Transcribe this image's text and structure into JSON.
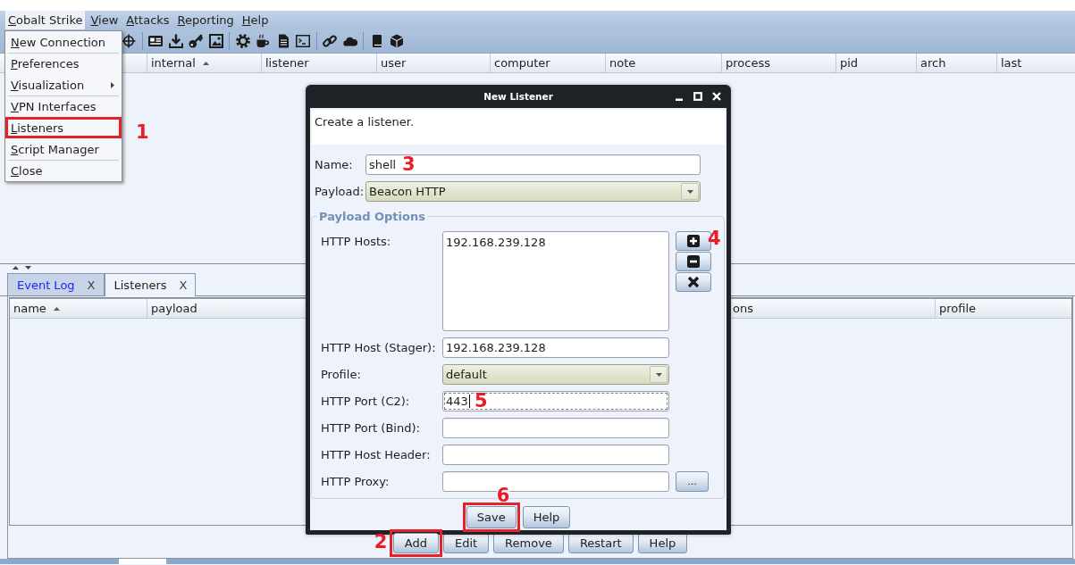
{
  "menu_bar": {
    "items": [
      {
        "label": "Cobalt Strike",
        "selected": true
      },
      {
        "label": "View",
        "selected": false
      },
      {
        "label": "Attacks",
        "selected": false
      },
      {
        "label": "Reporting",
        "selected": false
      },
      {
        "label": "Help",
        "selected": false
      }
    ]
  },
  "open_menu": {
    "items": [
      {
        "kind": "item",
        "label": "New Connection",
        "highlighted": false
      },
      {
        "kind": "separator"
      },
      {
        "kind": "item",
        "label": "Preferences",
        "highlighted": false
      },
      {
        "kind": "submenu",
        "label": "Visualization",
        "highlighted": false
      },
      {
        "kind": "separator"
      },
      {
        "kind": "item",
        "label": "VPN Interfaces",
        "highlighted": false
      },
      {
        "kind": "item",
        "label": "Listeners",
        "highlighted": true,
        "annotation": "1"
      },
      {
        "kind": "item",
        "label": "Script Manager",
        "highlighted": false
      },
      {
        "kind": "separator"
      },
      {
        "kind": "item",
        "label": "Close",
        "highlighted": false
      }
    ]
  },
  "sessions_table": {
    "columns": [
      {
        "label": "internal",
        "sorted": true
      },
      {
        "label": "listener",
        "sorted": false
      },
      {
        "label": "user",
        "sorted": false
      },
      {
        "label": "computer",
        "sorted": false
      },
      {
        "label": "note",
        "sorted": false
      },
      {
        "label": "process",
        "sorted": false
      },
      {
        "label": "pid",
        "sorted": false
      },
      {
        "label": "arch",
        "sorted": false
      },
      {
        "label": "last",
        "sorted": false
      }
    ]
  },
  "tabs": [
    {
      "label": "Event Log",
      "close": "X",
      "selected": false,
      "activity": true
    },
    {
      "label": "Listeners",
      "close": "X",
      "selected": true,
      "activity": false
    }
  ],
  "listeners_table": {
    "columns": [
      {
        "label": "name",
        "sorted": true
      },
      {
        "label": "payload",
        "sorted": false
      },
      {
        "label": "ons",
        "sorted": false
      },
      {
        "label": "profile",
        "sorted": false
      }
    ]
  },
  "listener_buttons": [
    {
      "label": "Add",
      "highlighted": true,
      "annotation": "2"
    },
    {
      "label": "Edit",
      "highlighted": false
    },
    {
      "label": "Remove",
      "highlighted": false
    },
    {
      "label": "Restart",
      "highlighted": false
    },
    {
      "label": "Help",
      "highlighted": false
    }
  ],
  "dialog": {
    "title": "New Listener",
    "description": "Create a listener.",
    "fields": [
      {
        "kind": "text",
        "label": "Name:",
        "value": "shell",
        "focused": false,
        "annotation": "3"
      },
      {
        "kind": "select",
        "label": "Payload:",
        "value": "Beacon HTTP"
      }
    ],
    "payload_options": {
      "title": "Payload Options",
      "fields": [
        {
          "kind": "list",
          "label": "HTTP Hosts:",
          "items": [
            "192.168.239.128"
          ],
          "buttons": [
            {
              "kind": "add",
              "annotation": "4"
            },
            {
              "kind": "remove"
            },
            {
              "kind": "clear"
            }
          ]
        },
        {
          "kind": "text",
          "label": "HTTP Host (Stager):",
          "value": "192.168.239.128",
          "focused": false
        },
        {
          "kind": "select",
          "label": "Profile:",
          "value": "default"
        },
        {
          "kind": "text",
          "label": "HTTP Port (C2):",
          "value": "443",
          "focused": true,
          "annotation": "5"
        },
        {
          "kind": "text",
          "label": "HTTP Port (Bind):",
          "focused": false
        },
        {
          "kind": "text",
          "label": "HTTP Host Header:",
          "focused": false
        },
        {
          "kind": "browse",
          "label": "HTTP Proxy:",
          "button": "...",
          "focused": false
        }
      ]
    },
    "buttons": [
      {
        "label": "Save",
        "highlighted": true,
        "annotation": "6"
      },
      {
        "label": "Help",
        "highlighted": false
      }
    ]
  }
}
